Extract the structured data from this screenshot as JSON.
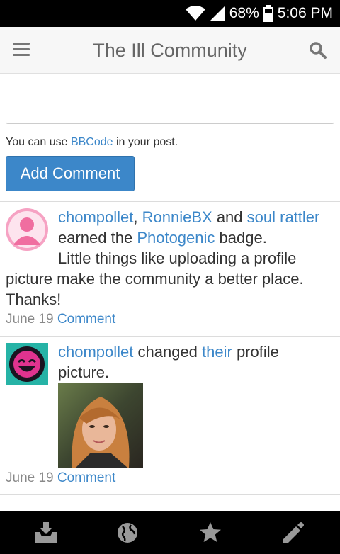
{
  "status_bar": {
    "battery": "68%",
    "time": "5:06 PM"
  },
  "header": {
    "title": "The Ill Community"
  },
  "compose": {
    "note_before": "You can use ",
    "bbcode_link": "BBCode",
    "note_after": " in your post.",
    "add_comment_label": "Add Comment"
  },
  "activities": [
    {
      "users": [
        "chompollet",
        "RonnieBX",
        "soul rattler"
      ],
      "sep1": ", ",
      "sep2": " and ",
      "text_before_badge": "earned the ",
      "badge": "Photogenic",
      "text_after_badge": " badge.",
      "message_line1": "Little things like uploading a profile",
      "message_rest": "picture make the community a better place. Thanks!",
      "date": "June 19",
      "comment_link": "Comment"
    },
    {
      "user": "chompollet",
      "text1": " changed ",
      "pronoun": "their",
      "text2": " profile",
      "text3": "picture.",
      "date": "June 19",
      "comment_link": "Comment"
    }
  ],
  "colors": {
    "link": "#3c87c9",
    "button": "#3c87c9",
    "avatar1_bg": "#f6a2c3",
    "avatar2_bg": "#26b3a6"
  }
}
